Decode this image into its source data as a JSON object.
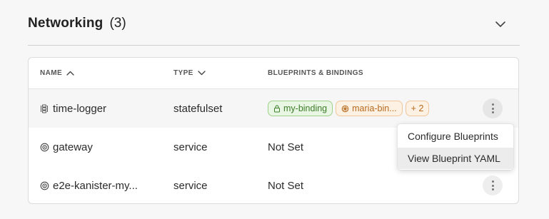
{
  "section": {
    "title": "Networking",
    "count": "(3)"
  },
  "table": {
    "headers": {
      "name": "NAME",
      "type": "TYPE",
      "blueprints": "BLUEPRINTS & BINDINGS"
    },
    "sort": {
      "name": "ascending",
      "type": "descending"
    },
    "rows": [
      {
        "icon": "statefulset-icon",
        "name": "time-logger",
        "type": "statefulset",
        "tags": [
          {
            "label": "my-binding",
            "icon": "lock-icon",
            "color": "#3b7d28"
          },
          {
            "label": "maria-bin...",
            "icon": "blueprint-icon",
            "color": "#b76a1c"
          },
          {
            "label": "+ 2",
            "color": "#b76a1c"
          }
        ]
      },
      {
        "icon": "service-icon",
        "name": "gateway",
        "type": "service",
        "blueprints": "Not Set"
      },
      {
        "icon": "service-icon",
        "name": "e2e-kanister-my...",
        "type": "service",
        "blueprints": "Not Set"
      }
    ]
  },
  "context_menu": {
    "items": [
      "Configure Blueprints",
      "View Blueprint YAML"
    ],
    "highlighted": "View Blueprint YAML"
  }
}
